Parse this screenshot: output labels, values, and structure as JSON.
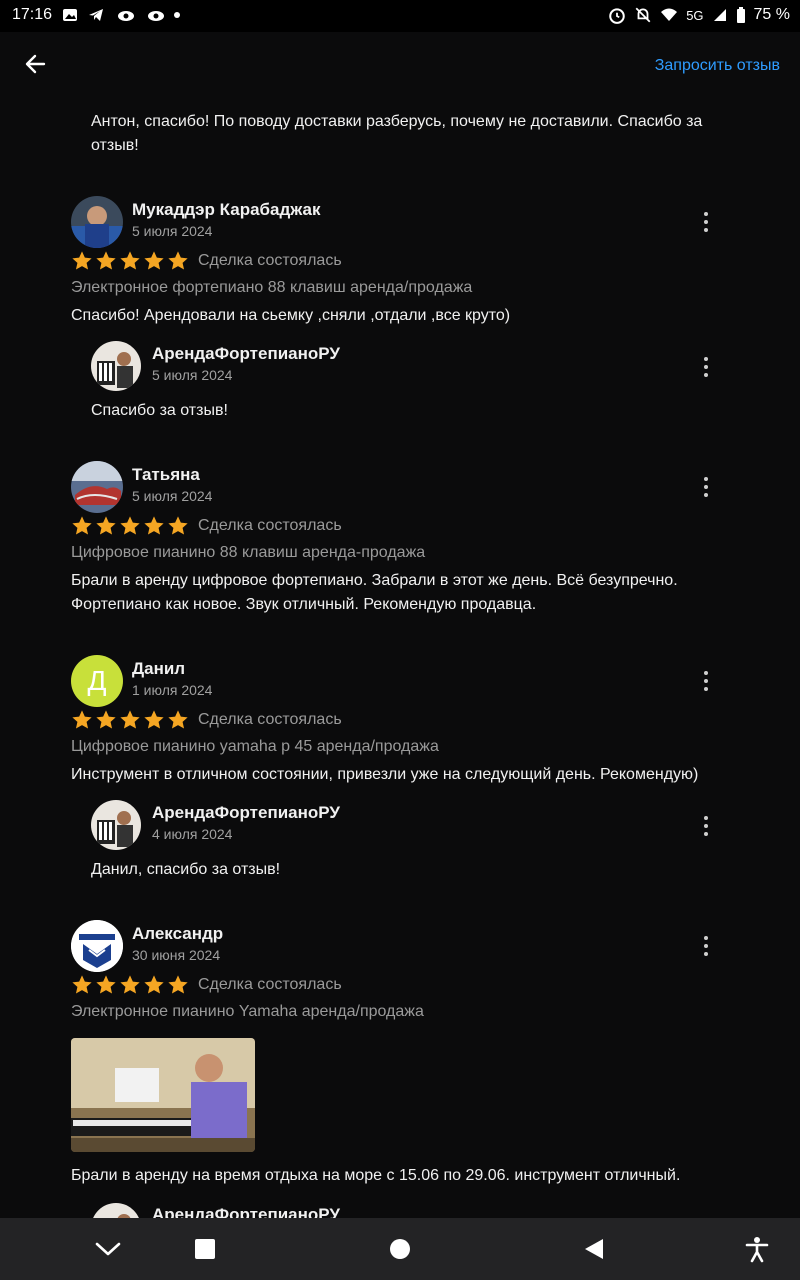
{
  "status": {
    "time": "17:16",
    "network": "5G",
    "battery": "75 %"
  },
  "appbar": {
    "back_icon": "arrow-left-icon",
    "request_review": "Запросить отзыв"
  },
  "top_reply": {
    "text": "Антон, спасибо! По поводу доставки разберусь, почему не доставили. Спасибо за отзыв!"
  },
  "reviews": [
    {
      "name": "Мукаддэр Карабаджак",
      "date": "5 июля 2024",
      "rating": 5,
      "deal": "Сделка состоялась",
      "item": "Электронное фортепиано 88 клавиш аренда/продажа",
      "text": "Спасибо! Арендовали на сьемку ,сняли ,отдали ,все круто)",
      "reply": {
        "name": "АрендаФортепианоРУ",
        "date": "5 июля 2024",
        "text": "Спасибо за отзыв!"
      }
    },
    {
      "name": "Татьяна",
      "date": "5 июля 2024",
      "rating": 5,
      "deal": "Сделка состоялась",
      "item": "Цифровое пианино 88 клавиш аренда-продажа",
      "text": "Брали в аренду цифровое фортепиано. Забрали в этот же день. Всё безупречно. Фортепиано как новое. Звук отличный. Рекомендую продавца."
    },
    {
      "name": "Данил",
      "avatar_letter": "Д",
      "date": "1 июля 2024",
      "rating": 5,
      "deal": "Сделка состоялась",
      "item": "Цифровое пианино yamaha p 45 аренда/продажа",
      "text": "Инструмент в отличном состоянии, привезли уже на следующий день. Рекомендую)",
      "reply": {
        "name": "АрендаФортепианоРУ",
        "date": "4 июля 2024",
        "text": "Данил, спасибо за отзыв!"
      }
    },
    {
      "name": "Александр",
      "date": "30 июня 2024",
      "rating": 5,
      "deal": "Сделка состоялась",
      "item": "Электронное пианино Yamaha аренда/продажа",
      "text": "Брали в аренду на время отдыха на море с 15.06 по 29.06. инструмент отличный.",
      "reply": {
        "name": "АрендаФортепианоРУ"
      }
    }
  ],
  "colors": {
    "star": "#f5a623",
    "link": "#2f9cff",
    "avatar_green": "#c8e03a"
  },
  "navbar": {
    "icons": [
      "chevron-down-icon",
      "square-icon",
      "circle-icon",
      "triangle-back-icon",
      "accessibility-icon"
    ]
  }
}
